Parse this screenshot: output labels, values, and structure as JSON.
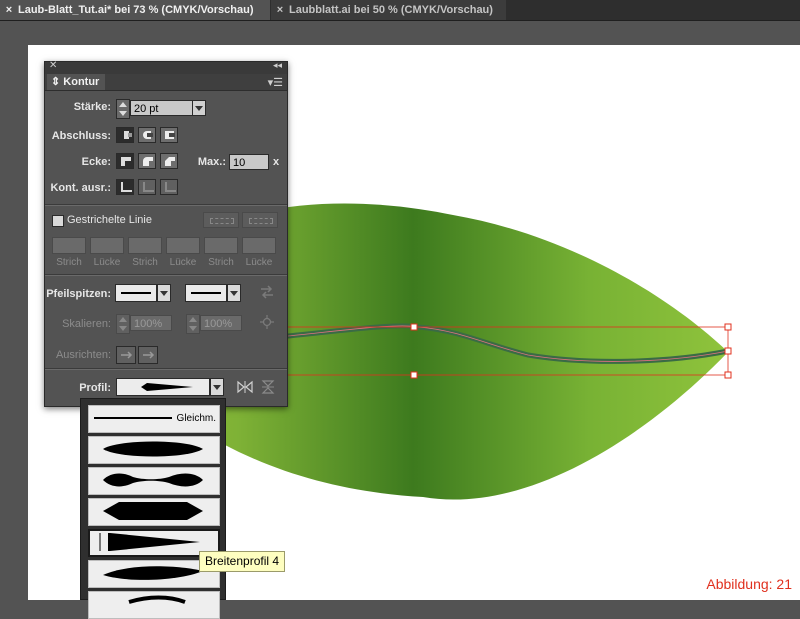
{
  "tabs": [
    {
      "label": "Laub-Blatt_Tut.ai* bei 73 % (CMYK/Vorschau)",
      "active": true
    },
    {
      "label": "Laubblatt.ai bei 50 % (CMYK/Vorschau)",
      "active": false
    }
  ],
  "icons": {
    "tab_close": "×"
  },
  "panel": {
    "title": "Kontur",
    "staerke": {
      "label": "Stärke:",
      "value": "20 pt"
    },
    "abschluss_label": "Abschluss:",
    "ecke": {
      "label": "Ecke:",
      "max_label": "Max.:",
      "max_value": "10",
      "max_unit": "x"
    },
    "kont_label": "Kont. ausr.:",
    "dashed": {
      "label": "Gestrichelte Linie",
      "checked": false,
      "cells": [
        "Strich",
        "Lücke",
        "Strich",
        "Lücke",
        "Strich",
        "Lücke"
      ]
    },
    "arrows": {
      "label": "Pfeilspitzen:"
    },
    "scale": {
      "label": "Skalieren:",
      "value1": "100%",
      "value2": "100%"
    },
    "align_label": "Ausrichten:",
    "profile_label": "Profil:"
  },
  "profile_list": {
    "items": [
      {
        "name": "uniform",
        "label": "Gleichm."
      },
      {
        "name": "width-profile-1",
        "label": ""
      },
      {
        "name": "width-profile-2",
        "label": ""
      },
      {
        "name": "width-profile-3",
        "label": ""
      },
      {
        "name": "width-profile-4",
        "label": "",
        "selected": true
      },
      {
        "name": "width-profile-5",
        "label": ""
      }
    ]
  },
  "tooltip": "Breitenprofil 4",
  "figure_label": "Abbildung: 21",
  "colors": {
    "leaf_light": "#8dbf3a",
    "leaf_dark": "#3d7a1e",
    "selection": "#e0301e",
    "stroke": "#3a6b45"
  }
}
